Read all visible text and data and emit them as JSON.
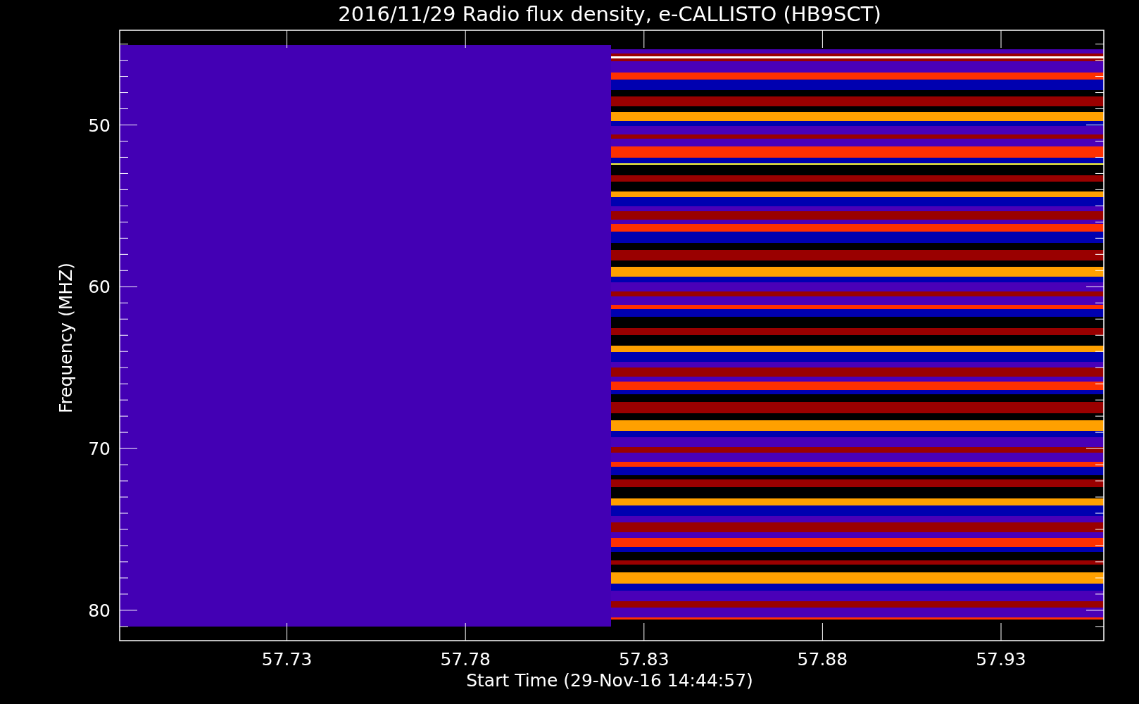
{
  "chart": {
    "title": "2016/11/29  Radio flux density, e-CALLISTO (HB9SCT)",
    "xlabel": "Start Time (29-Nov-16 14:44:57)",
    "ylabel": "Frequency (MHZ)",
    "yticks": [
      "50",
      "60",
      "70",
      "80"
    ],
    "xticks": [
      "57.73",
      "57.78",
      "57.83",
      "57.88",
      "57.93"
    ]
  }
}
